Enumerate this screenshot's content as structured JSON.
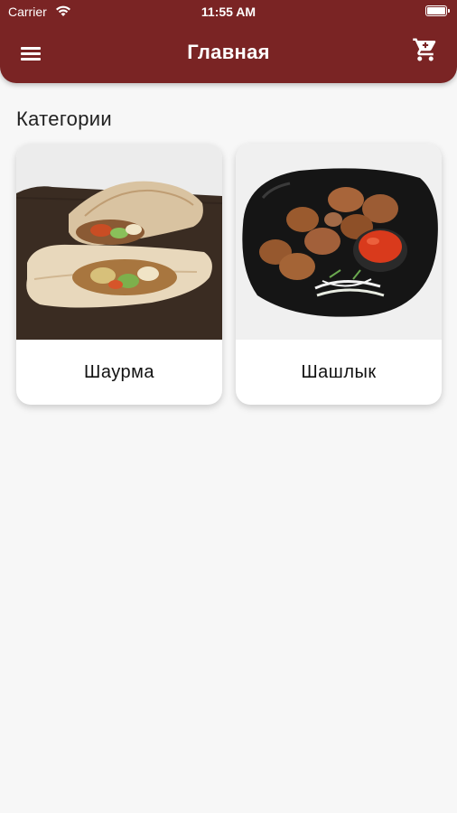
{
  "status_bar": {
    "carrier": "Carrier",
    "time": "11:55 AM"
  },
  "header": {
    "title": "Главная",
    "background_color": "#7a2424",
    "menu_icon": "hamburger-menu-icon",
    "cart_icon": "shopping-cart-icon"
  },
  "main": {
    "section_title": "Категории",
    "categories": [
      {
        "label": "Шаурма",
        "image": "shawarma-photo"
      },
      {
        "label": "Шашлык",
        "image": "shashlik-photo"
      }
    ]
  }
}
